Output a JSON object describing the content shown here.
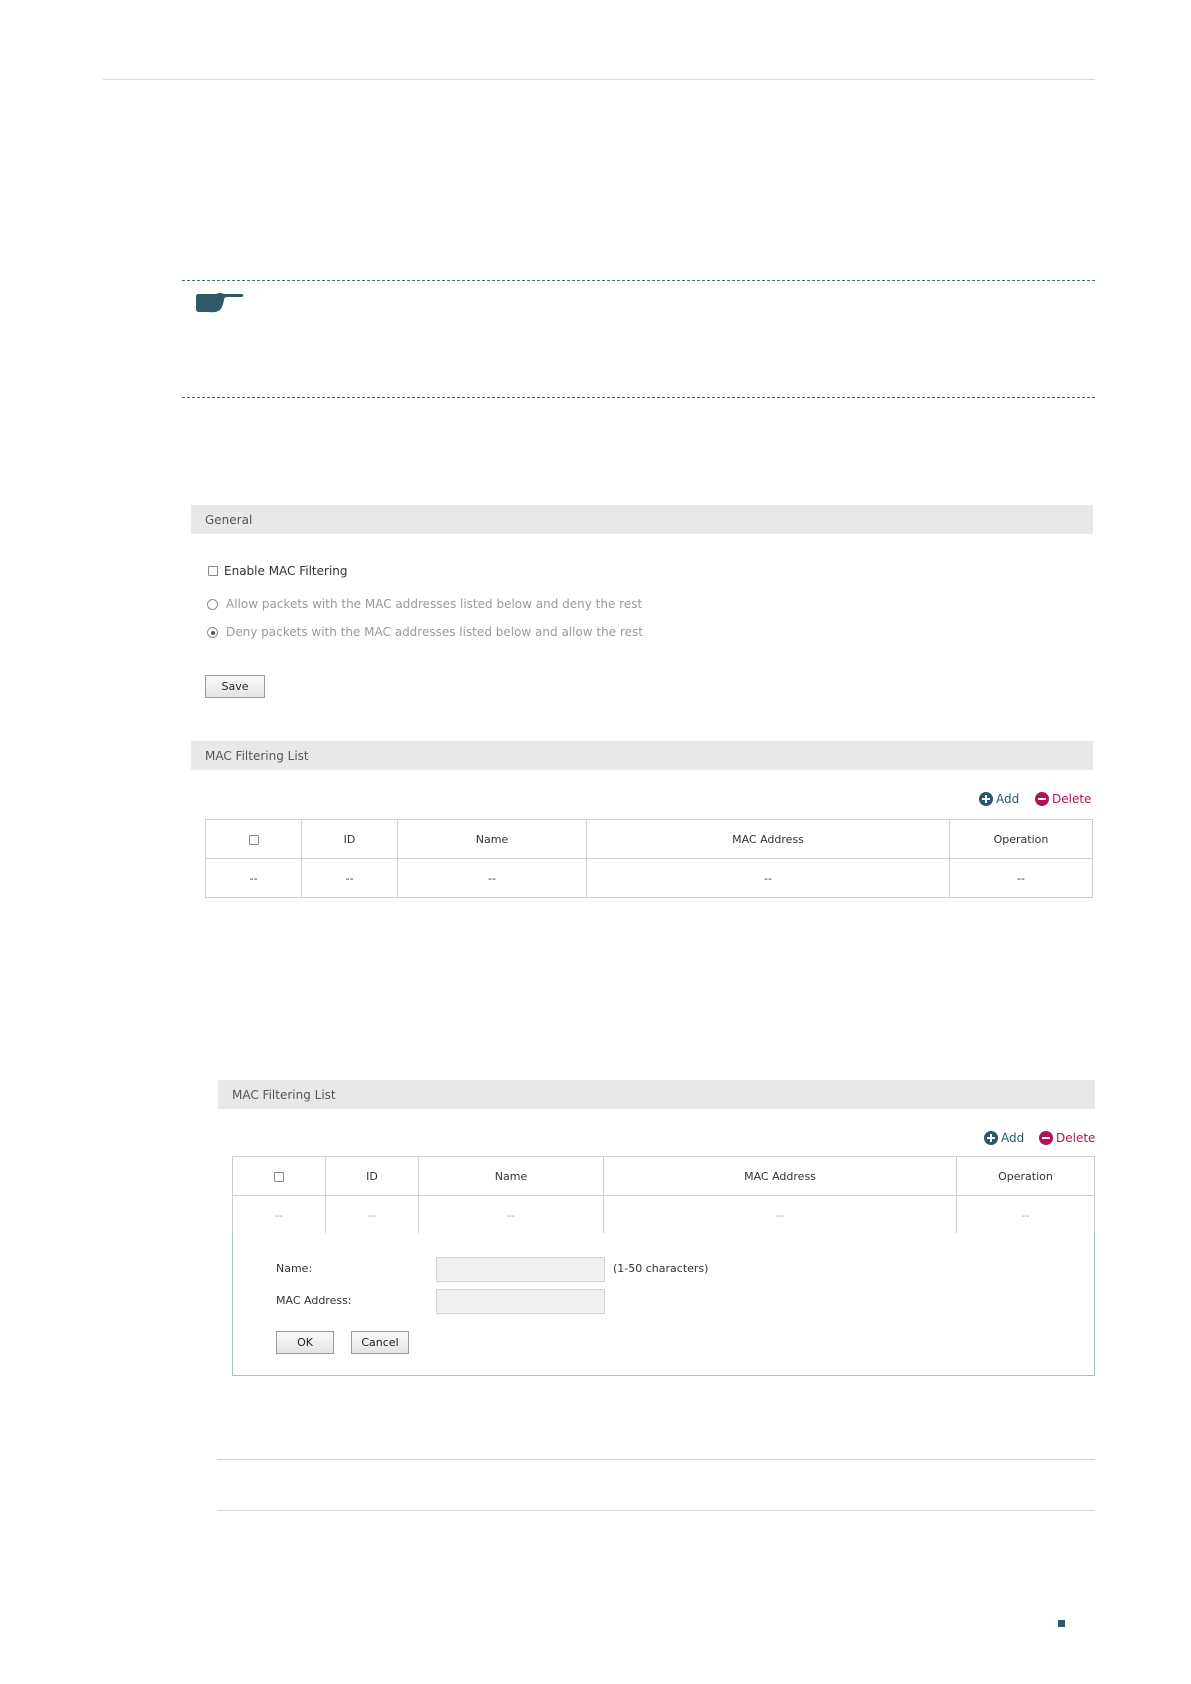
{
  "general_section": {
    "title": "General",
    "enable_label": "Enable MAC Filtering",
    "allow_label": "Allow packets with the MAC addresses listed below and deny the rest",
    "deny_label": "Deny packets with the MAC addresses listed below and allow the rest",
    "save_label": "Save"
  },
  "list_section": {
    "title": "MAC Filtering List",
    "add_label": "Add",
    "delete_label": "Delete",
    "columns": [
      "ID",
      "Name",
      "MAC Address",
      "Operation"
    ],
    "row": [
      "--",
      "--",
      "--",
      "--",
      "--"
    ]
  },
  "list_section_edit": {
    "title": "MAC Filtering List",
    "add_label": "Add",
    "delete_label": "Delete",
    "columns": [
      "ID",
      "Name",
      "MAC Address",
      "Operation"
    ],
    "row": [
      "--",
      "--",
      "--",
      "--",
      "--"
    ],
    "form": {
      "name_label": "Name:",
      "name_hint": "(1-50 characters)",
      "name_value": "",
      "mac_label": "MAC Address:",
      "mac_value": "",
      "ok_label": "OK",
      "cancel_label": "Cancel"
    }
  },
  "colors": {
    "accent": "#2b5766",
    "delete": "#b0135a",
    "section_bar": "#e8e8e8"
  }
}
